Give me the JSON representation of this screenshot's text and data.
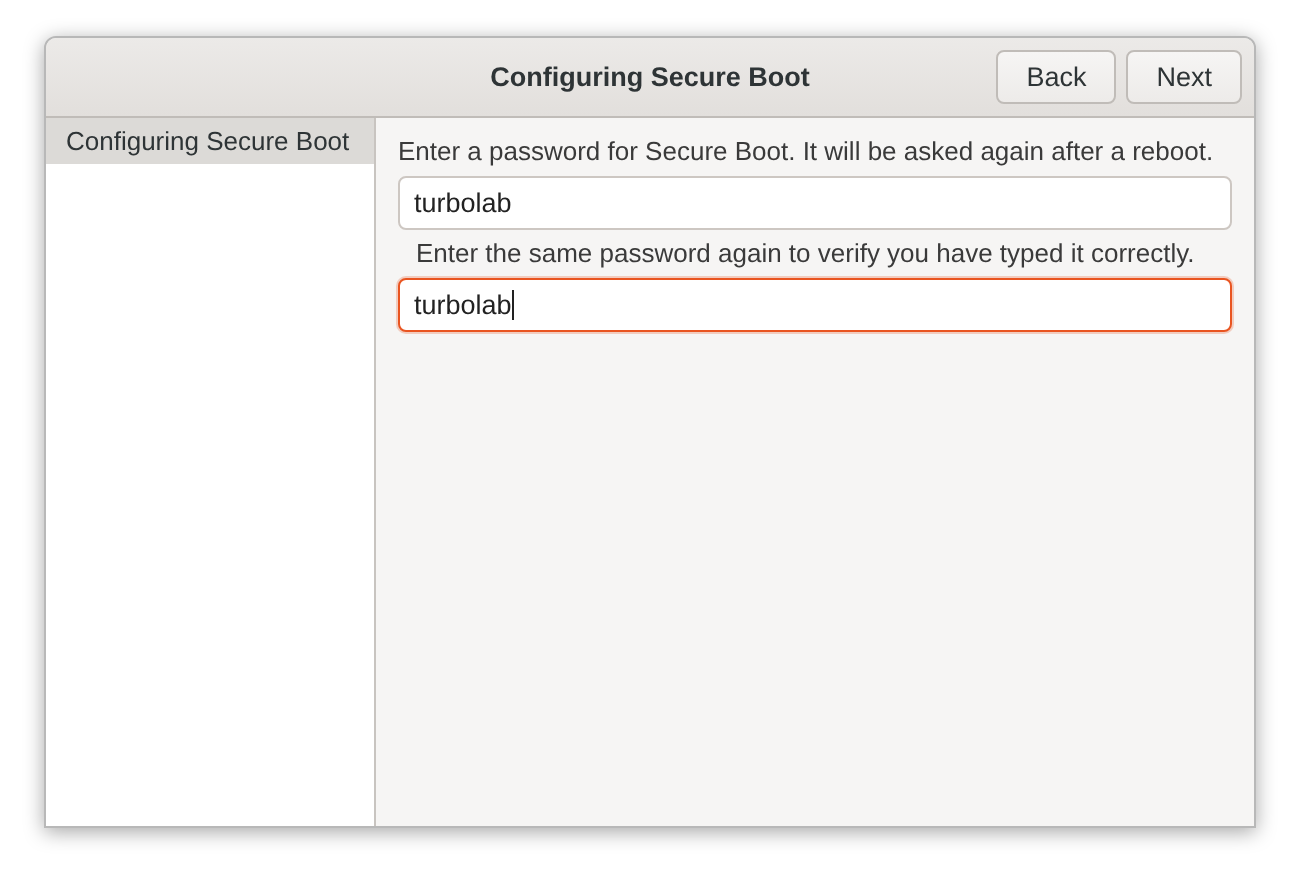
{
  "window": {
    "title": "Configuring Secure Boot"
  },
  "header_buttons": [
    {
      "label": "Back"
    },
    {
      "label": "Next"
    }
  ],
  "sidebar": {
    "items": [
      {
        "label": "Configuring Secure Boot",
        "selected": true
      }
    ]
  },
  "form": [
    {
      "label": "Enter a password for Secure Boot. It will be asked again after a reboot.",
      "value": "turbolab",
      "focused": false
    },
    {
      "label": "Enter the same password again to verify you have typed it correctly.",
      "value": "turbolab",
      "focused": true
    }
  ]
}
